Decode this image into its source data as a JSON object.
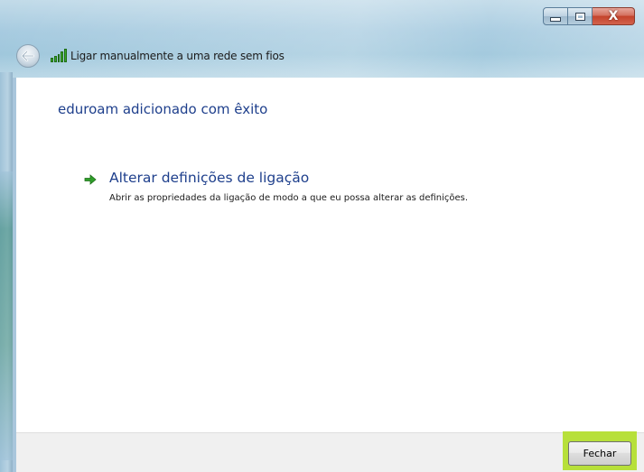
{
  "window": {
    "title": "Ligar manualmente a uma rede sem fios",
    "caption_buttons": {
      "minimize_icon": "minimize-icon",
      "maximize_icon": "maximize-icon",
      "close_icon": "close-icon",
      "close_glyph": "X"
    }
  },
  "nav": {
    "back_icon": "back-arrow-icon",
    "network_icon": "wireless-signal-icon"
  },
  "content": {
    "heading": "eduroam adicionado com êxito",
    "option": {
      "icon": "green-arrow-icon",
      "title": "Alterar definições de ligação",
      "description": "Abrir as propriedades da ligação de modo a que eu possa alterar as definições."
    }
  },
  "footer": {
    "close_label": "Fechar",
    "highlight_color": "#b7e03a"
  },
  "colors": {
    "link": "#1e3f8c",
    "accent_green": "#3aa92a"
  }
}
